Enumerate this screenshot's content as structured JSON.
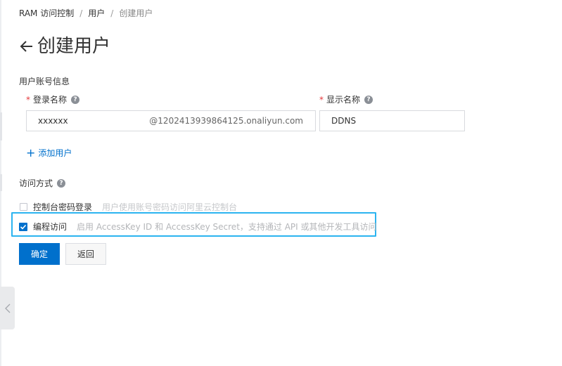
{
  "breadcrumb": {
    "items": [
      "RAM 访问控制",
      "用户",
      "创建用户"
    ],
    "separator": "/"
  },
  "header": {
    "back_icon": "arrow-left-icon",
    "title": "创建用户"
  },
  "form": {
    "section_title": "用户账号信息",
    "login_name": {
      "label": "登录名称",
      "required_mark": "*",
      "value": "xxxxxx",
      "suffix": "@1202413939864125.onaliyun.com"
    },
    "display_name": {
      "label": "显示名称",
      "required_mark": "*",
      "value": "DDNS"
    },
    "help_icon_glyph": "?",
    "add_user": {
      "icon": "plus-icon",
      "glyph": "+",
      "label": "添加用户"
    }
  },
  "access": {
    "title": "访问方式",
    "options": [
      {
        "label": "控制台密码登录",
        "description": "用户使用账号密码访问阿里云控制台",
        "checked": false
      },
      {
        "label": "编程访问",
        "description": "启用 AccessKey ID 和 AccessKey Secret，支持通过 API 或其他开发工具访问",
        "checked": true
      }
    ]
  },
  "buttons": {
    "confirm": "确定",
    "back": "返回"
  },
  "colors": {
    "primary": "#0070cc",
    "required": "#e4393c",
    "highlight": "#2bb4f0"
  }
}
